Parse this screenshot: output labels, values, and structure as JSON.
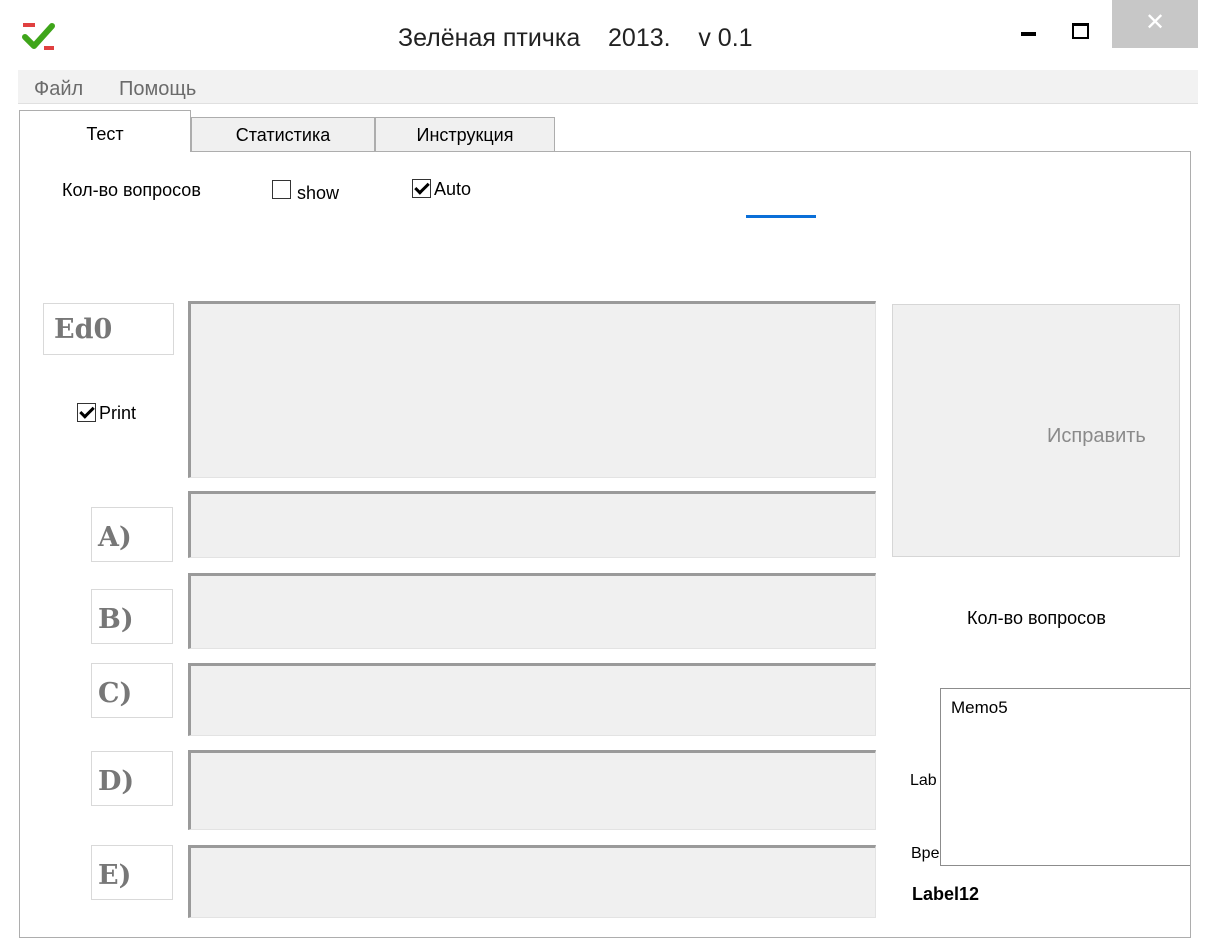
{
  "window": {
    "title": "Зелёная птичка    2013.    v 0.1",
    "minimize_glyph": "minimize-icon",
    "maximize_glyph": "maximize-icon",
    "close_glyph": "✕",
    "close_color": "#c7c7c7"
  },
  "menu": {
    "items": [
      {
        "label": "Файл"
      },
      {
        "label": "Помощь"
      }
    ]
  },
  "tabs": [
    {
      "label": "Тест",
      "active": true
    },
    {
      "label": "Статистика",
      "active": false
    },
    {
      "label": "Инструкция",
      "active": false
    }
  ],
  "top_controls": {
    "questions_label": "Кол-во вопросов",
    "show_checkbox": {
      "label": "show",
      "checked": false
    },
    "auto_checkbox": {
      "label": "Auto",
      "checked": true
    },
    "progress_color": "#0a6fd8"
  },
  "question": {
    "editor_label": "Ed0",
    "print_checkbox": {
      "label": "Print",
      "checked": true
    },
    "question_text": ""
  },
  "answers": [
    {
      "label": "A)",
      "text": ""
    },
    {
      "label": "B)",
      "text": ""
    },
    {
      "label": "C)",
      "text": ""
    },
    {
      "label": "D)",
      "text": ""
    },
    {
      "label": "E)",
      "text": ""
    }
  ],
  "side": {
    "fix_button_label": "Исправить",
    "questions_label": "Кол-во вопросов",
    "label_partial": "Lab",
    "time_label_partial": "Вре",
    "label12": "Label12",
    "memo5_text": "Memo5"
  }
}
